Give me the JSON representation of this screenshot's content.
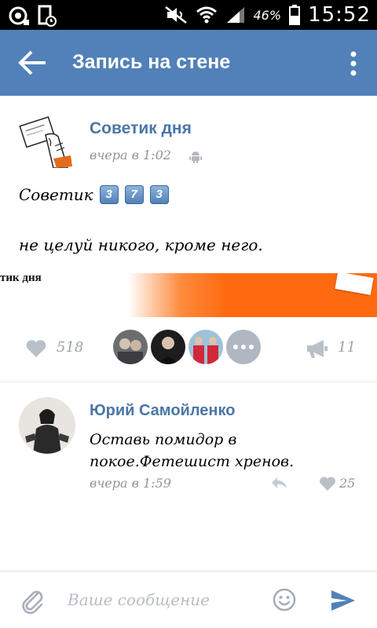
{
  "status_bar": {
    "battery_percent": "46%",
    "time": "15:52"
  },
  "app_bar": {
    "title": "Запись на стене"
  },
  "post": {
    "author": "Советик дня",
    "time": "вчера в 1:02",
    "text_prefix": "Советик",
    "number_keycaps": [
      "3",
      "7",
      "3"
    ],
    "text_line2": "не целуй никого, кроме него.",
    "banner_text": "тик дня",
    "likes_count": "518",
    "shares_count": "11"
  },
  "comment": {
    "author": "Юрий Самойленко",
    "text": "Оставь помидор в покое.Фетешист хренов.",
    "time": "вчера в 1:59",
    "likes_count": "25"
  },
  "input": {
    "placeholder": "Ваше сообщение"
  },
  "colors": {
    "app_bar": "#5181b8",
    "link_blue": "#4a76a8",
    "banner_orange": "#ff6a10"
  },
  "icons": [
    "back-arrow-icon",
    "more-vertical-icon",
    "heart-icon",
    "megaphone-icon",
    "reply-icon",
    "paperclip-icon",
    "smiley-icon",
    "send-icon",
    "android-icon"
  ]
}
